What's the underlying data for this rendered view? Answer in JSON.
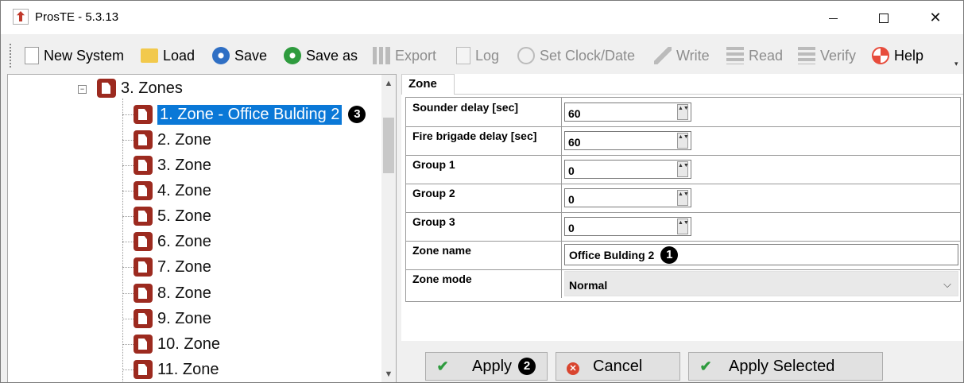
{
  "window": {
    "title": "ProsTE - 5.3.13",
    "minimize": "",
    "maximize": "",
    "close": "✕"
  },
  "toolbar": {
    "new_system": "New System",
    "load": "Load",
    "save": "Save",
    "save_as": "Save as",
    "export": "Export",
    "log": "Log",
    "set_clock": "Set Clock/Date",
    "write": "Write",
    "read": "Read",
    "verify": "Verify",
    "help": "Help",
    "overflow": "▾"
  },
  "tree": {
    "parent": "3. Zones",
    "expander": "−",
    "selected_badge": "3",
    "items": [
      "1. Zone - Office Bulding 2",
      "2. Zone",
      "3. Zone",
      "4. Zone",
      "5. Zone",
      "6. Zone",
      "7. Zone",
      "8. Zone",
      "9. Zone",
      "10. Zone",
      "11. Zone"
    ],
    "scroll_up": "▲",
    "scroll_down": "▼"
  },
  "panel": {
    "tab": "Zone",
    "rows": {
      "sounder_delay": {
        "label": "Sounder delay [sec]",
        "value": "60"
      },
      "fire_brigade_delay": {
        "label": "Fire brigade delay [sec]",
        "value": "60"
      },
      "group1": {
        "label": "Group 1",
        "value": "0"
      },
      "group2": {
        "label": "Group 2",
        "value": "0"
      },
      "group3": {
        "label": "Group 3",
        "value": "0"
      },
      "zone_name": {
        "label": "Zone name",
        "value": "Office Bulding 2",
        "badge": "1"
      },
      "zone_mode": {
        "label": "Zone mode",
        "value": "Normal"
      }
    },
    "spin_glyph": "▲▼"
  },
  "buttons": {
    "apply": "Apply",
    "apply_badge": "2",
    "cancel": "Cancel",
    "apply_selected": "Apply Selected",
    "check_glyph": "✔",
    "x_glyph": "✕"
  }
}
